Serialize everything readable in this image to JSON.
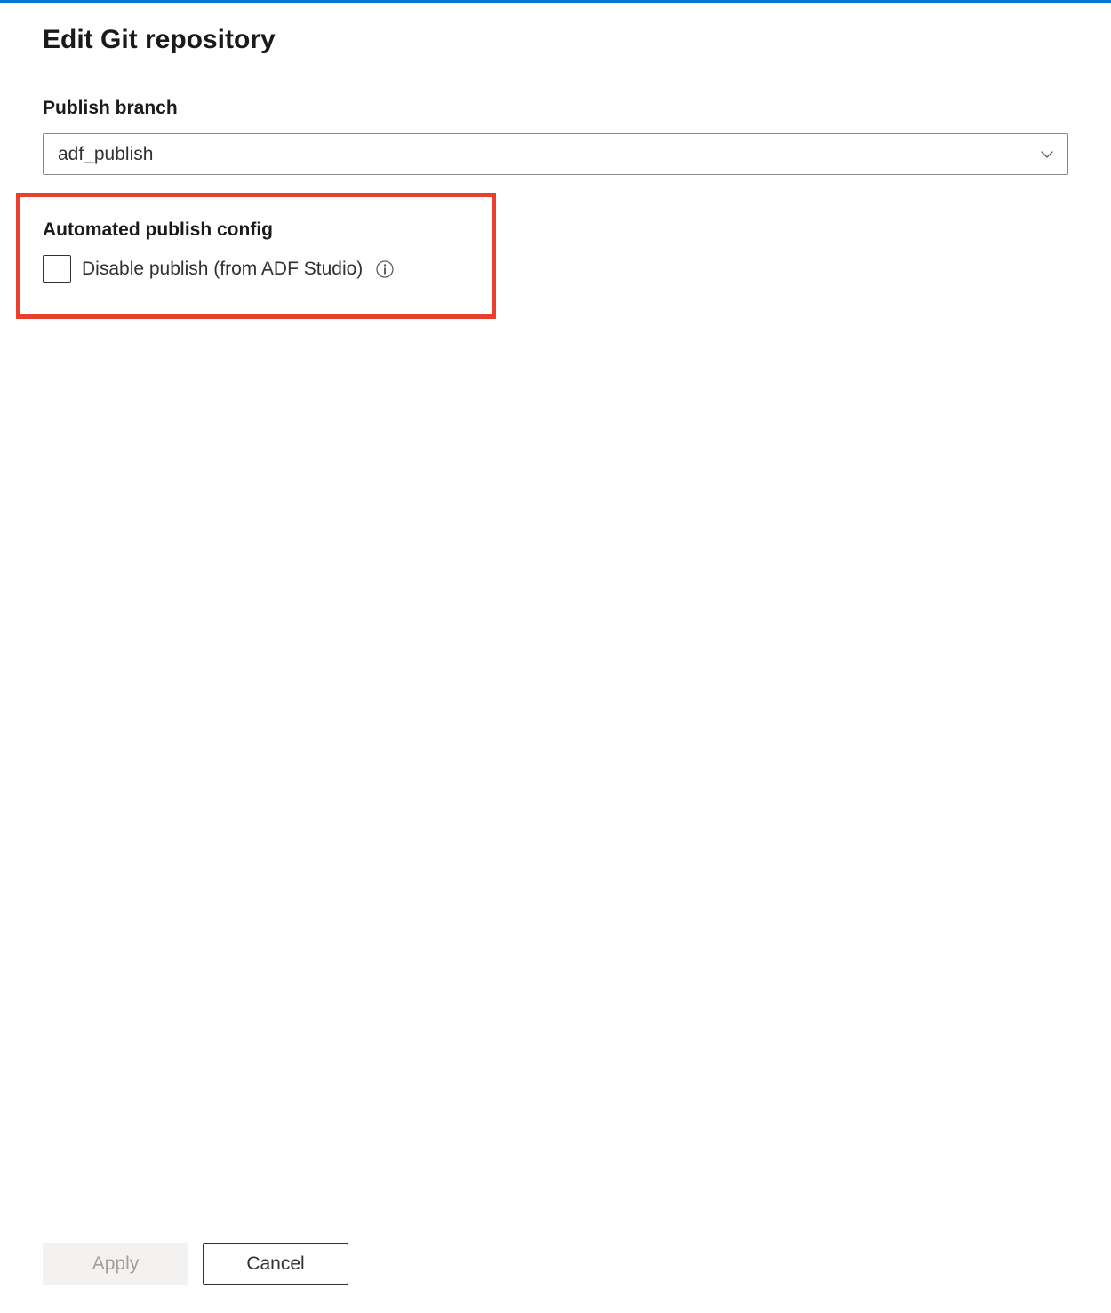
{
  "title": "Edit Git repository",
  "publishBranch": {
    "label": "Publish branch",
    "value": "adf_publish"
  },
  "automatedPublish": {
    "label": "Automated publish config",
    "checkboxLabel": "Disable publish (from ADF Studio)",
    "checked": false
  },
  "buttons": {
    "apply": "Apply",
    "cancel": "Cancel"
  }
}
